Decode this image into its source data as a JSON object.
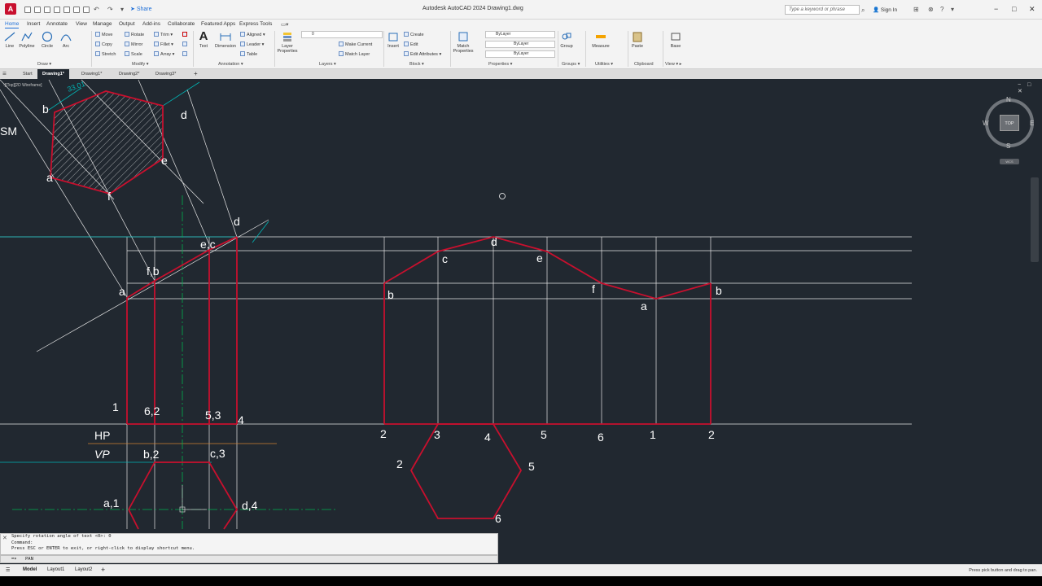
{
  "titlebar": {
    "logo": "A",
    "share": "Share",
    "title": "Autodesk AutoCAD 2024   Drawing1.dwg",
    "search_placeholder": "Type a keyword or phrase",
    "sign_in": "Sign In"
  },
  "ribbon_tabs": [
    "Home",
    "Insert",
    "Annotate",
    "View",
    "Manage",
    "Output",
    "Add-ins",
    "Collaborate",
    "Featured Apps",
    "Express Tools"
  ],
  "ribbon": {
    "draw": {
      "line": "Line",
      "polyline": "Polyline",
      "circle": "Circle",
      "arc": "Arc",
      "label": "Draw"
    },
    "modify": {
      "move": "Move",
      "rotate": "Rotate",
      "trim": "Trim",
      "copy": "Copy",
      "mirror": "Mirror",
      "fillet": "Fillet",
      "stretch": "Stretch",
      "scale": "Scale",
      "array": "Array",
      "label": "Modify"
    },
    "annotation": {
      "text": "Text",
      "dimension": "Dimension",
      "aligned": "Aligned",
      "leader": "Leader",
      "table": "Table",
      "label": "Annotation"
    },
    "layers": {
      "layer_properties": "Layer Properties",
      "layer_combo": "0",
      "make_current": "Make Current",
      "match_layer": "Match Layer",
      "label": "Layers"
    },
    "block": {
      "insert": "Insert",
      "create": "Create",
      "edit": "Edit",
      "edit_attributes": "Edit Attributes",
      "label": "Block"
    },
    "properties": {
      "match_properties": "Match Properties",
      "bylayer1": "ByLayer",
      "bylayer2": "ByLayer",
      "bylayer3": "ByLayer",
      "label": "Properties"
    },
    "groups": {
      "group": "Group",
      "label": "Groups"
    },
    "utilities": {
      "measure": "Measure",
      "label": "Utilities"
    },
    "clipboard": {
      "paste": "Paste",
      "label": "Clipboard"
    },
    "view": {
      "base": "Base",
      "label": "View"
    }
  },
  "doc_tabs": [
    "Start",
    "Drawing1*",
    "Drawing1*",
    "Drawing2*",
    "Drawing3*"
  ],
  "viewport_label": "-][Top][2D Wireframe]",
  "viewcube": {
    "n": "N",
    "s": "S",
    "e": "E",
    "w": "W",
    "top": "TOP",
    "wcs": "WCS"
  },
  "drawing_labels": {
    "sm": "SM",
    "dim": "33.01",
    "hex_top": [
      "b",
      "d",
      "e",
      "a",
      "f"
    ],
    "fv": [
      "d",
      "e,c",
      "f,b",
      "a"
    ],
    "fv_bottom": [
      "1",
      "6,2",
      "5,3",
      "4"
    ],
    "hp": "HP",
    "vp": "VP",
    "tv": [
      "b,2",
      "c,3",
      "a,1",
      "d,4"
    ],
    "dev_top": [
      "d",
      "c",
      "e",
      "b",
      "f",
      "a",
      "b"
    ],
    "dev_bottom": [
      "2",
      "3",
      "4",
      "5",
      "6",
      "1",
      "2"
    ],
    "hex_dev": [
      "2",
      "5",
      "6"
    ]
  },
  "command": {
    "history": [
      "Specify rotation angle of text <0>: 0",
      "Command:",
      "Press ESC or ENTER to exit, or right-click to display shortcut menu."
    ],
    "input": "PAN"
  },
  "status": {
    "tabs": [
      "Model",
      "Layout1",
      "Layout2"
    ],
    "message": "Press pick button and drag to pan."
  },
  "colors": {
    "background": "#212830",
    "red": "#c8102e",
    "cyan": "#00b5b5",
    "green": "#00b050"
  }
}
